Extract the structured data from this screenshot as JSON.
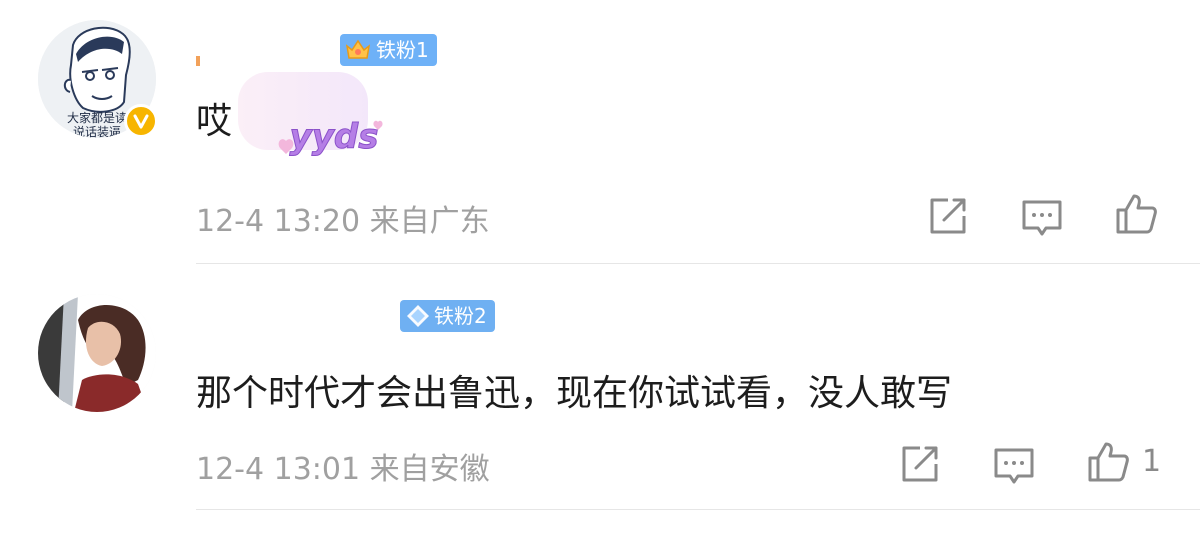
{
  "comments": [
    {
      "fan_badge": "铁粉1",
      "text": "哎",
      "sticker_text": "yyds",
      "time": "12-4 13:20",
      "location": "来自广东",
      "avatar_caption_1": "大家都是读",
      "avatar_caption_2": "说话装逼",
      "like_count": ""
    },
    {
      "fan_badge": "铁粉2",
      "text": "那个时代才会出鲁迅，现在你试试看，没人敢写",
      "time": "12-4 13:01",
      "location": "来自安徽",
      "like_count": "1"
    }
  ],
  "icons": {
    "share": "share-icon",
    "reply": "reply-icon",
    "like": "thumb-up-icon"
  },
  "colors": {
    "badge_bg": "#6eb1f7",
    "meta_text": "#a0a0a0",
    "verified": "#f7b500"
  }
}
